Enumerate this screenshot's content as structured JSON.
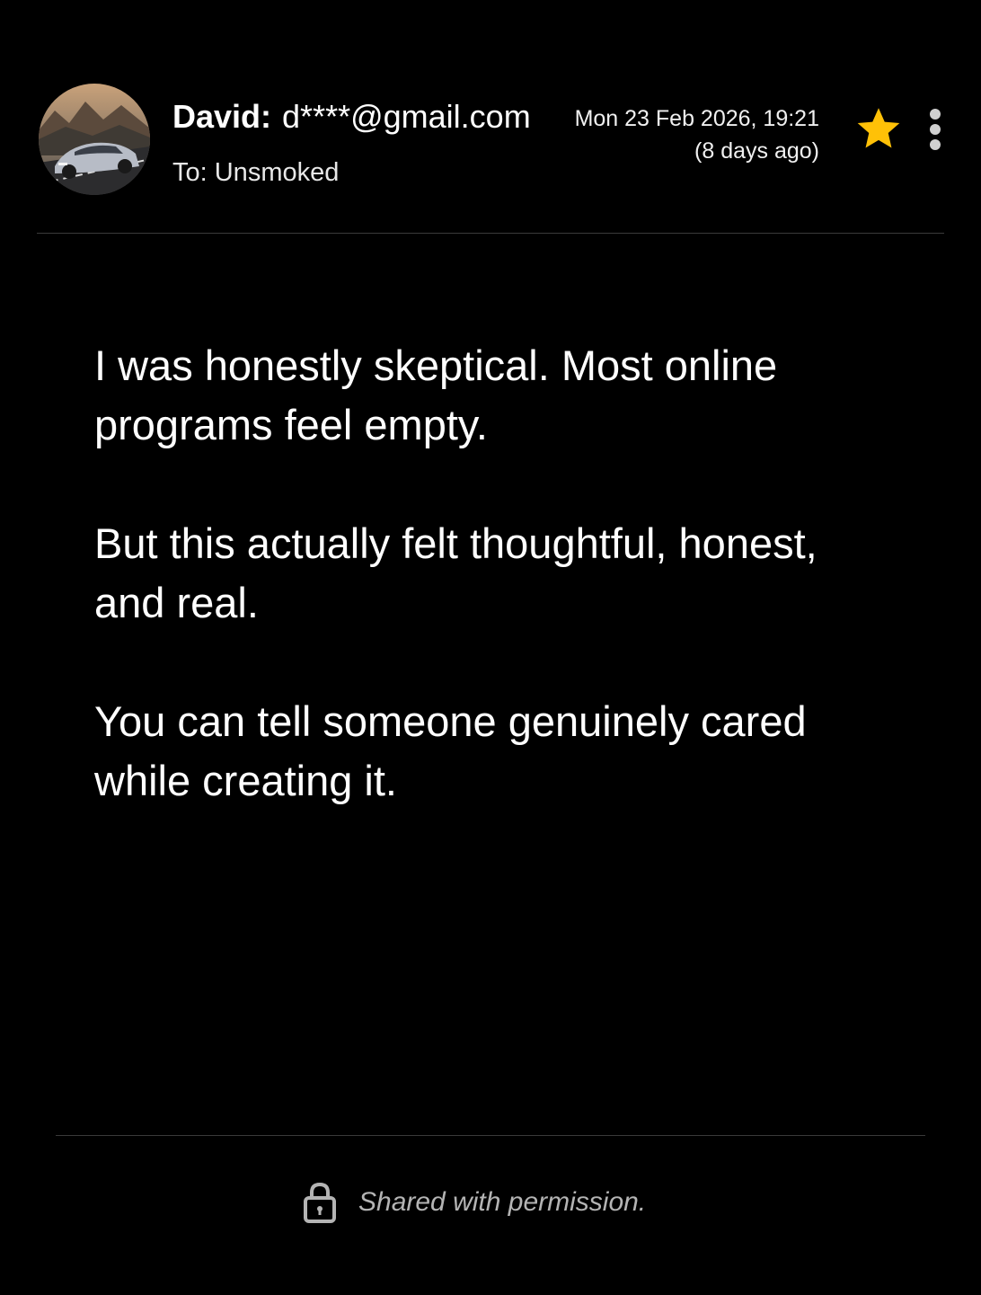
{
  "email": {
    "sender": {
      "name": "David:",
      "email": "d****@gmail.com",
      "avatar_icon": "car-photo-avatar"
    },
    "recipient": "To: Unsmoked",
    "date": "Mon 23 Feb 2026, 19:21",
    "relative_date": "(8 days ago)",
    "starred": true,
    "star_color": "#FFC107",
    "icons": {
      "star": "star-icon",
      "more": "more-vert-icon",
      "lock": "lock-icon"
    }
  },
  "message": {
    "paragraphs": [
      "I was honestly skeptical. Most online programs feel empty.",
      "But this actually felt thoughtful, honest, and real.",
      "You can tell someone genuinely cared while creating it."
    ]
  },
  "footer": {
    "text": "Shared with permission."
  }
}
